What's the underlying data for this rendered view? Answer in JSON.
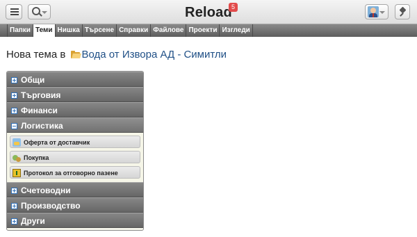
{
  "header": {
    "title": "Reload",
    "notification_count": "5",
    "menu_icon": "hamburger-menu-icon",
    "search_icon": "search-icon",
    "user_icon": "user-avatar-icon",
    "pin_icon": "pin-icon"
  },
  "tabs": [
    {
      "label": "Папки",
      "active": false
    },
    {
      "label": "Теми",
      "active": true
    },
    {
      "label": "Нишка",
      "active": false
    },
    {
      "label": "Търсене",
      "active": false
    },
    {
      "label": "Справки",
      "active": false
    },
    {
      "label": "Файлове",
      "active": false
    },
    {
      "label": "Проекти",
      "active": false
    },
    {
      "label": "Изгледи",
      "active": false
    }
  ],
  "heading": {
    "prefix": "Нова тема в",
    "folder_icon": "folder-open-icon",
    "folder_name": "Вода от Извора АД - Симитли"
  },
  "accordion": {
    "groups": [
      {
        "label": "Общи",
        "state": "collapsed"
      },
      {
        "label": "Търговия",
        "state": "collapsed"
      },
      {
        "label": "Финанси",
        "state": "collapsed"
      },
      {
        "label": "Логистика",
        "state": "expanded",
        "items": [
          {
            "label": "Оферта от доставчик",
            "icon": "offer-icon"
          },
          {
            "label": "Покупка",
            "icon": "purchase-icon"
          },
          {
            "label": "Протокол за отговорно пазене",
            "icon": "protocol-icon"
          }
        ]
      },
      {
        "label": "Счетоводни",
        "state": "collapsed"
      },
      {
        "label": "Производство",
        "state": "collapsed"
      },
      {
        "label": "Други",
        "state": "collapsed"
      }
    ]
  },
  "colors": {
    "tab_bar": "#6f6f6f",
    "accordion_header": "#767676",
    "link": "#1f4f86",
    "badge": "#e24b4b"
  }
}
